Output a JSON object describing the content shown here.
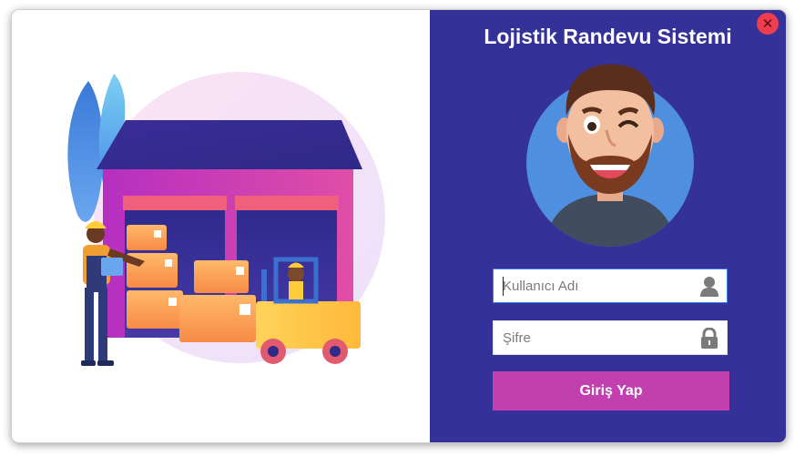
{
  "window": {
    "title": "Lojistik Randevu Sistemi",
    "close_icon": "close-icon"
  },
  "illustration": {
    "subject": "warehouse-logistics",
    "icons": [
      "warehouse-icon",
      "worker-icon",
      "forklift-icon",
      "boxes-icon"
    ]
  },
  "avatar": {
    "icon": "winking-man-avatar-icon"
  },
  "form": {
    "username": {
      "placeholder": "Kullanıcı Adı",
      "value": "",
      "icon": "user-icon"
    },
    "password": {
      "placeholder": "Şifre",
      "value": "",
      "icon": "lock-icon"
    },
    "login_label": "Giriş Yap"
  },
  "colors": {
    "panel_bg": "#343199",
    "button": "#c13fae",
    "close": "#ee3d4f",
    "avatar_circle": "#4e8fe0"
  }
}
